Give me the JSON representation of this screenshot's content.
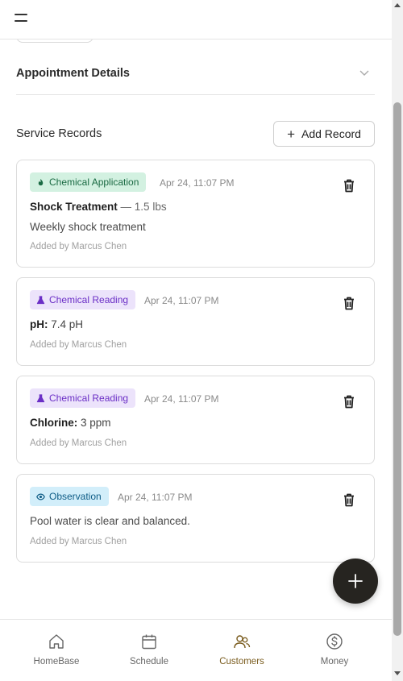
{
  "appointment": {
    "title": "Appointment Details"
  },
  "service_records": {
    "title": "Service Records",
    "add_label": "Add Record",
    "records": [
      {
        "type": "Chemical Application",
        "time": "Apr 24, 11:07 PM",
        "main": "Shock Treatment",
        "sub": " — 1.5 lbs",
        "note": "Weekly shock treatment",
        "added_by": "Added by Marcus Chen"
      },
      {
        "type": "Chemical Reading",
        "time": "Apr 24, 11:07 PM",
        "main": "pH:",
        "val": " 7.4 pH",
        "added_by": "Added by Marcus Chen"
      },
      {
        "type": "Chemical Reading",
        "time": "Apr 24, 11:07 PM",
        "main": "Chlorine:",
        "val": " 3 ppm",
        "added_by": "Added by Marcus Chen"
      },
      {
        "type": "Observation",
        "time": "Apr 24, 11:07 PM",
        "note": "Pool water is clear and balanced.",
        "added_by": "Added by Marcus Chen"
      }
    ]
  },
  "nav": {
    "items": [
      {
        "label": "HomeBase",
        "icon": "home-icon"
      },
      {
        "label": "Schedule",
        "icon": "calendar-icon"
      },
      {
        "label": "Customers",
        "icon": "users-icon",
        "active": true
      },
      {
        "label": "Money",
        "icon": "dollar-icon"
      }
    ]
  },
  "colors": {
    "accent": "#7a5c1e",
    "application_badge": "#d3f1e1",
    "reading_badge": "#ece3fb",
    "observation_badge": "#d2eefa",
    "fab": "#262420"
  }
}
